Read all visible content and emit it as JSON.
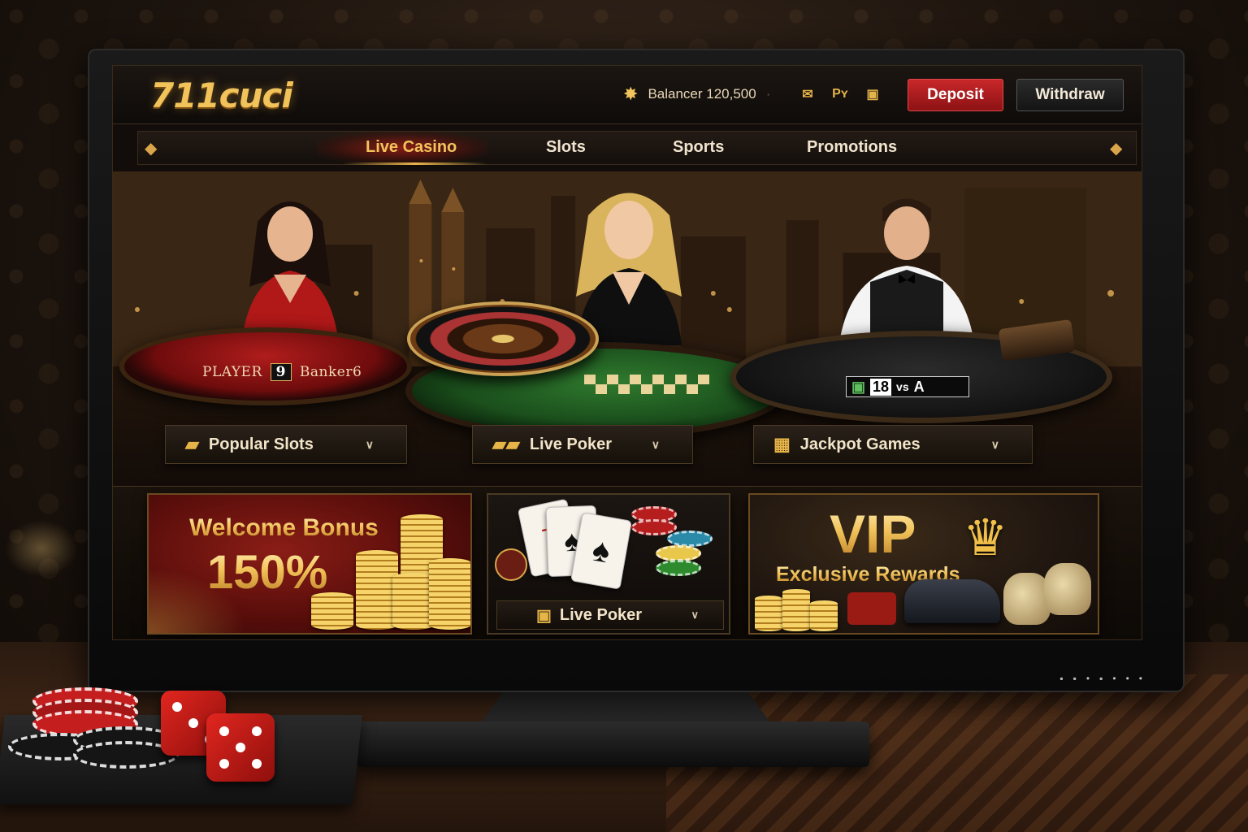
{
  "header": {
    "logo": "711cuci",
    "balance_label": "Balancer 120,500",
    "mini_icons": [
      "envelope-icon",
      "pay-icon",
      "card-icon"
    ],
    "mini_icon_text": [
      "✉",
      "Pʏ",
      "▣"
    ],
    "deposit_label": "Deposit",
    "withdraw_label": "Withdraw",
    "accent_red": "#c9272a",
    "accent_gold": "#f1c45c"
  },
  "nav": {
    "tabs": [
      {
        "label": "Live Casino",
        "active": true
      },
      {
        "label": "Slots",
        "active": false
      },
      {
        "label": "Sports",
        "active": false
      },
      {
        "label": "Promotions",
        "active": false
      }
    ]
  },
  "hero": {
    "baccarat_label_left": "PLAYER",
    "baccarat_score": "9",
    "baccarat_label_right": "Banker6",
    "blackjack_num": "18",
    "blackjack_vs": "vs",
    "blackjack_card": "A"
  },
  "categories": [
    {
      "label": "Popular Slots",
      "icon": "slot-icon"
    },
    {
      "label": "Live Poker",
      "icon": "cards-icon"
    },
    {
      "label": "Jackpot Games",
      "icon": "jackpot-icon"
    }
  ],
  "promos": {
    "welcome": {
      "title": "Welcome Bonus",
      "value": "150%"
    },
    "poker": {
      "label": "Live Poker",
      "card_1": "7",
      "card_2": "♠"
    },
    "vip": {
      "title": "VIP",
      "subtitle": "Exclusive Rewards"
    }
  }
}
